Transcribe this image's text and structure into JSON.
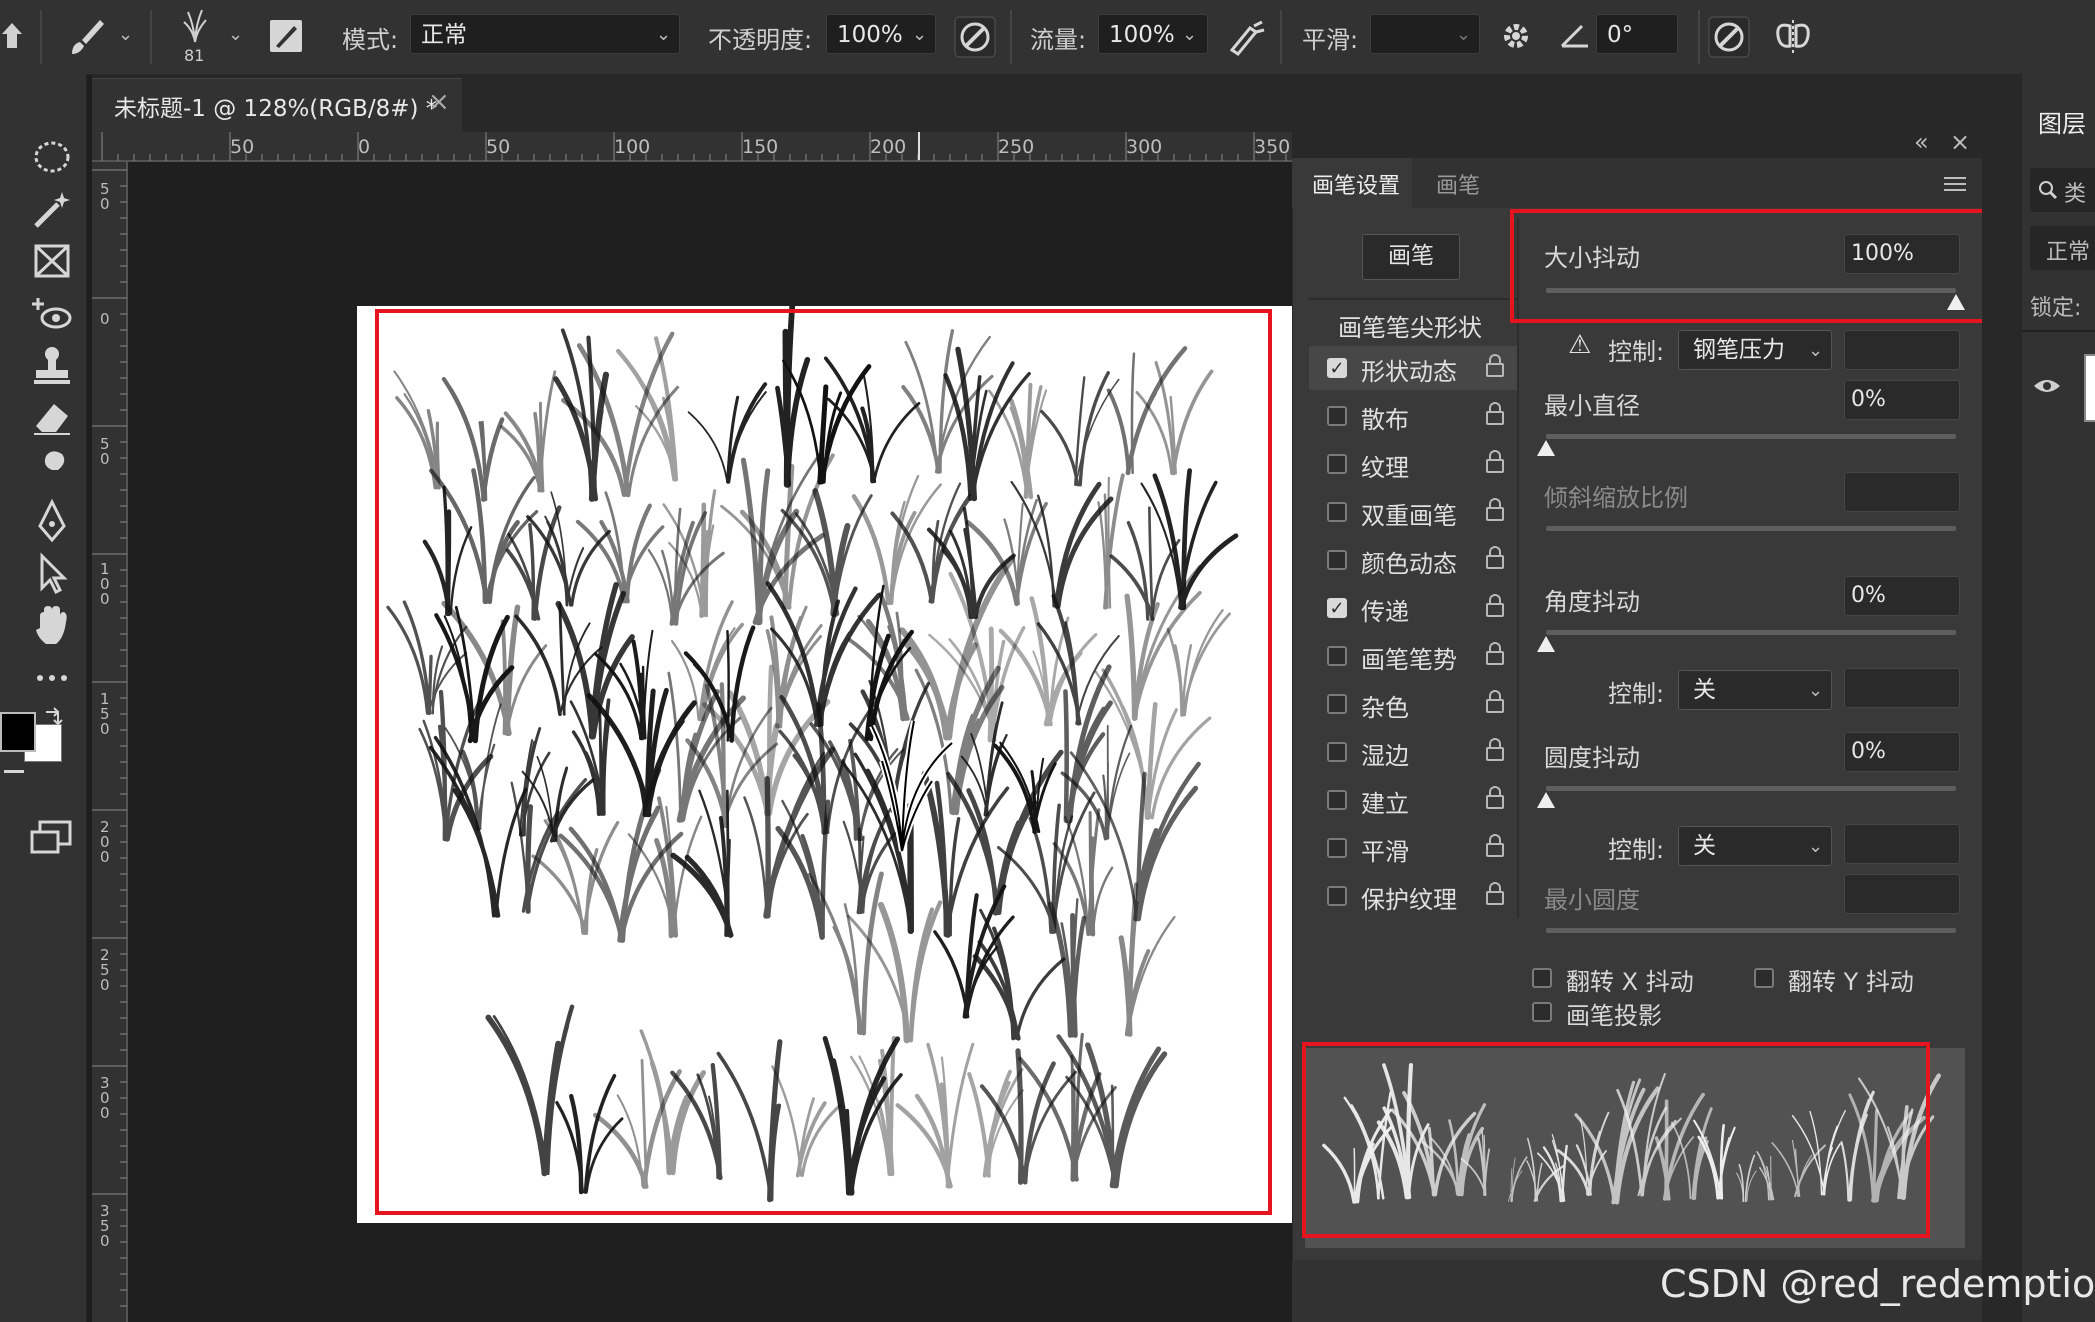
{
  "options_bar": {
    "brush_size": "81",
    "mode_label": "模式:",
    "mode_value": "正常",
    "opacity_label": "不透明度:",
    "opacity_value": "100%",
    "flow_label": "流量:",
    "flow_value": "100%",
    "smoothing_label": "平滑:",
    "smoothing_value": "",
    "angle_value": "0°"
  },
  "document": {
    "tab_title": "未标题-1 @ 128%(RGB/8#) *",
    "close_glyph": "×"
  },
  "ruler": {
    "h_ticks": [
      "50",
      "0",
      "50",
      "100",
      "150",
      "200",
      "250",
      "300",
      "350"
    ],
    "v_ticks": [
      "5\n0",
      "0",
      "5\n0",
      "1\n0\n0",
      "1\n5\n0",
      "2\n0\n0",
      "2\n5\n0",
      "3\n0\n0",
      "3\n5\n0"
    ]
  },
  "brush_panel": {
    "tab_settings": "画笔设置",
    "tab_brushes": "画笔",
    "collapse_glyph": "«",
    "close_glyph": "×",
    "brushes_button": "画笔",
    "tip_shape_heading": "画笔笔尖形状",
    "options": [
      {
        "label": "形状动态",
        "checked": true
      },
      {
        "label": "散布",
        "checked": false
      },
      {
        "label": "纹理",
        "checked": false
      },
      {
        "label": "双重画笔",
        "checked": false
      },
      {
        "label": "颜色动态",
        "checked": false
      },
      {
        "label": "传递",
        "checked": true
      },
      {
        "label": "画笔笔势",
        "checked": false
      },
      {
        "label": "杂色",
        "checked": false
      },
      {
        "label": "湿边",
        "checked": false
      },
      {
        "label": "建立",
        "checked": false
      },
      {
        "label": "平滑",
        "checked": false
      },
      {
        "label": "保护纹理",
        "checked": false
      }
    ],
    "size_jitter_label": "大小抖动",
    "size_jitter_value": "100%",
    "size_jitter_level": 1.0,
    "control_label": "控制:",
    "control_value_1": "钢笔压力",
    "min_diameter_label": "最小直径",
    "min_diameter_value": "0%",
    "min_diameter_level": 0.0,
    "tilt_scale_label": "倾斜缩放比例",
    "angle_jitter_label": "角度抖动",
    "angle_jitter_value": "0%",
    "angle_jitter_level": 0.0,
    "control_value_2": "关",
    "roundness_jitter_label": "圆度抖动",
    "roundness_jitter_value": "0%",
    "roundness_jitter_level": 0.0,
    "control_value_3": "关",
    "min_roundness_label": "最小圆度",
    "flip_x_label": "翻转 X 抖动",
    "flip_y_label": "翻转 Y 抖动",
    "brush_projection_label": "画笔投影",
    "warning_glyph": "⚠"
  },
  "layers_panel": {
    "title": "图层",
    "search_hint": "类",
    "blend_mode": "正常",
    "lock_label": "锁定:"
  },
  "watermark": "CSDN @red_redemption",
  "colors": {
    "highlight_red": "#e5141f",
    "panel_bg": "#393939",
    "app_bg": "#1e1e1e"
  }
}
